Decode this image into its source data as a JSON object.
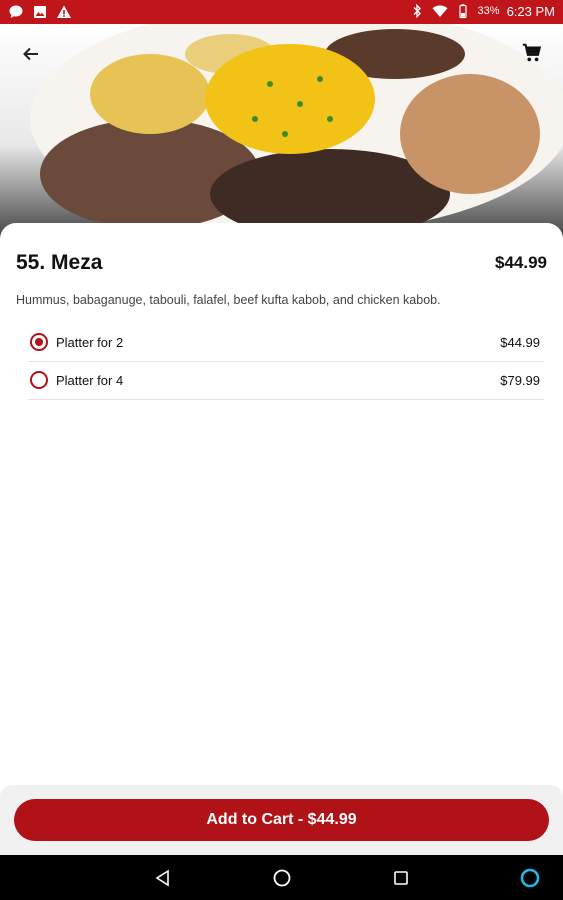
{
  "status_bar": {
    "battery_percent": "33%",
    "time": "6:23 PM",
    "left_icons": [
      "chat-bubble-icon",
      "image-icon",
      "warning-icon"
    ],
    "right_icons": [
      "bluetooth-icon",
      "wifi-icon",
      "battery-icon"
    ]
  },
  "header": {
    "back_icon": "arrow-left-icon",
    "cart_icon": "cart-icon"
  },
  "item": {
    "title": "55. Meza",
    "price": "$44.99",
    "description": "Hummus, babaganuge, tabouli, falafel, beef kufta kabob, and chicken kabob."
  },
  "options": [
    {
      "label": "Platter for 2",
      "price": "$44.99",
      "selected": true
    },
    {
      "label": "Platter for 4",
      "price": "$79.99",
      "selected": false
    }
  ],
  "footer": {
    "add_to_cart_label": "Add to Cart - $44.99"
  },
  "colors": {
    "brand_red": "#c0151a",
    "button_red": "#b01218"
  }
}
